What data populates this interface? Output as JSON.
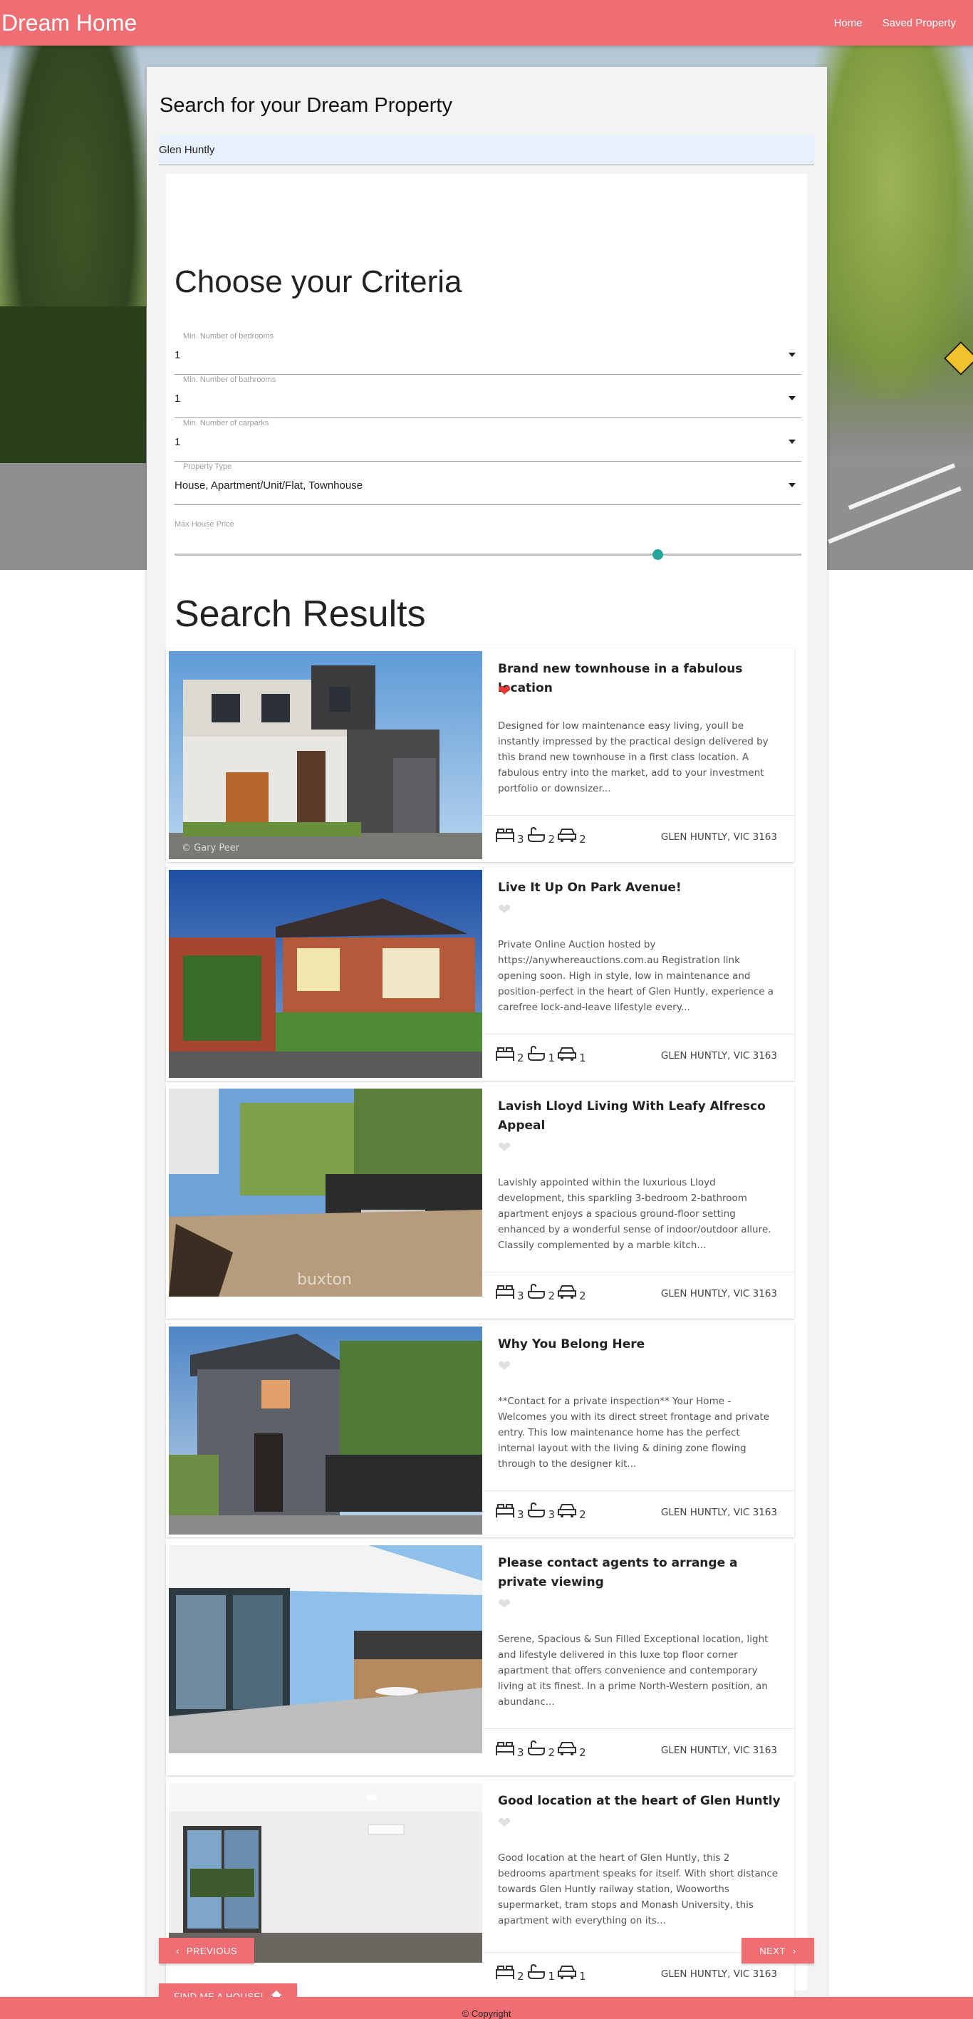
{
  "navbar": {
    "brand": "Dream Home",
    "links": [
      "Home",
      "Saved Property"
    ]
  },
  "search": {
    "title": "Search for your Dream Property",
    "value": "Glen Huntly"
  },
  "criteria": {
    "title": "Choose your Criteria",
    "fields": [
      {
        "label": "Min. Number of bedrooms",
        "value": "1"
      },
      {
        "label": "Min. Number of bathrooms",
        "value": "1"
      },
      {
        "label": "Min. Number of carparks",
        "value": "1"
      },
      {
        "label": "Property Type",
        "value": "House, Apartment/Unit/Flat, Townhouse"
      }
    ],
    "price_label": "Max House Price",
    "price_slider_fraction": 0.77
  },
  "results": {
    "title": "Search Results",
    "listings": [
      {
        "title": "Brand new townhouse in a fabulous location",
        "saved": true,
        "description": "Designed for low maintenance easy living, youll be instantly impressed by the practical design delivered by this brand new townhouse in a first class location. A fabulous entry into the market, add to your investment portfolio or downsizer...",
        "beds": "3",
        "baths": "2",
        "cars": "2",
        "address": "GLEN HUNTLY, VIC 3163",
        "photo_watermark": "© Gary Peer"
      },
      {
        "title": "Live It Up On Park Avenue!",
        "saved": false,
        "description": "Private Online Auction hosted by https://anywhereauctions.com.au Registration link opening soon. High in style, low in maintenance and position-perfect in the heart of Glen Huntly, experience a carefree lock-and-leave lifestyle every...",
        "beds": "2",
        "baths": "1",
        "cars": "1",
        "address": "GLEN HUNTLY, VIC 3163",
        "photo_watermark": ""
      },
      {
        "title": "Lavish Lloyd Living With Leafy Alfresco Appeal",
        "saved": false,
        "description": "Lavishly appointed within the luxurious Lloyd development, this sparkling 3-bedroom 2-bathroom apartment enjoys a spacious ground-floor setting enhanced by a wonderful sense of indoor/outdoor allure. Classily complemented by a marble kitch...",
        "beds": "3",
        "baths": "2",
        "cars": "2",
        "address": "GLEN HUNTLY, VIC 3163",
        "photo_watermark": "buxton"
      },
      {
        "title": "Why You Belong Here",
        "saved": false,
        "description": "**Contact for a private inspection** Your Home - Welcomes you with its direct street frontage and private entry. This low maintenance home has the perfect internal layout with the living & dining zone flowing through to the designer kit...",
        "beds": "3",
        "baths": "3",
        "cars": "2",
        "address": "GLEN HUNTLY, VIC 3163",
        "photo_watermark": ""
      },
      {
        "title": "Please contact agents to arrange a private viewing",
        "saved": false,
        "description": "Serene, Spacious & Sun Filled Exceptional location, light and lifestyle delivered in this luxe top floor corner apartment that offers convenience and contemporary living at its finest. In a prime North-Western position, an abundanc...",
        "beds": "3",
        "baths": "2",
        "cars": "2",
        "address": "GLEN HUNTLY, VIC 3163",
        "photo_watermark": ""
      },
      {
        "title": "Good location at the heart of Glen Huntly",
        "saved": false,
        "description": "Good location at the heart of Glen Huntly, this 2 bedrooms apartment speaks for itself. With short distance towards Glen Huntly railway station, Wooworths supermarket, tram stops and Monash University, this apartment with everything on its...",
        "beds": "2",
        "baths": "1",
        "cars": "1",
        "address": "GLEN HUNTLY, VIC 3163",
        "photo_watermark": ""
      }
    ]
  },
  "pagination": {
    "previous": "Previous",
    "next": "Next"
  },
  "find_button": "Find me a house!",
  "footer": {
    "text": "© Copyright"
  },
  "colors": {
    "primary": "#ee6e73",
    "slider": "#26a69a",
    "heart_on": "#e53935",
    "heart_off": "#e0e0e0"
  },
  "icons": [
    "bed-icon",
    "bath-icon",
    "car-icon",
    "heart-icon",
    "chevron-left-icon",
    "chevron-right-icon",
    "home-icon",
    "dropdown-caret-icon"
  ]
}
